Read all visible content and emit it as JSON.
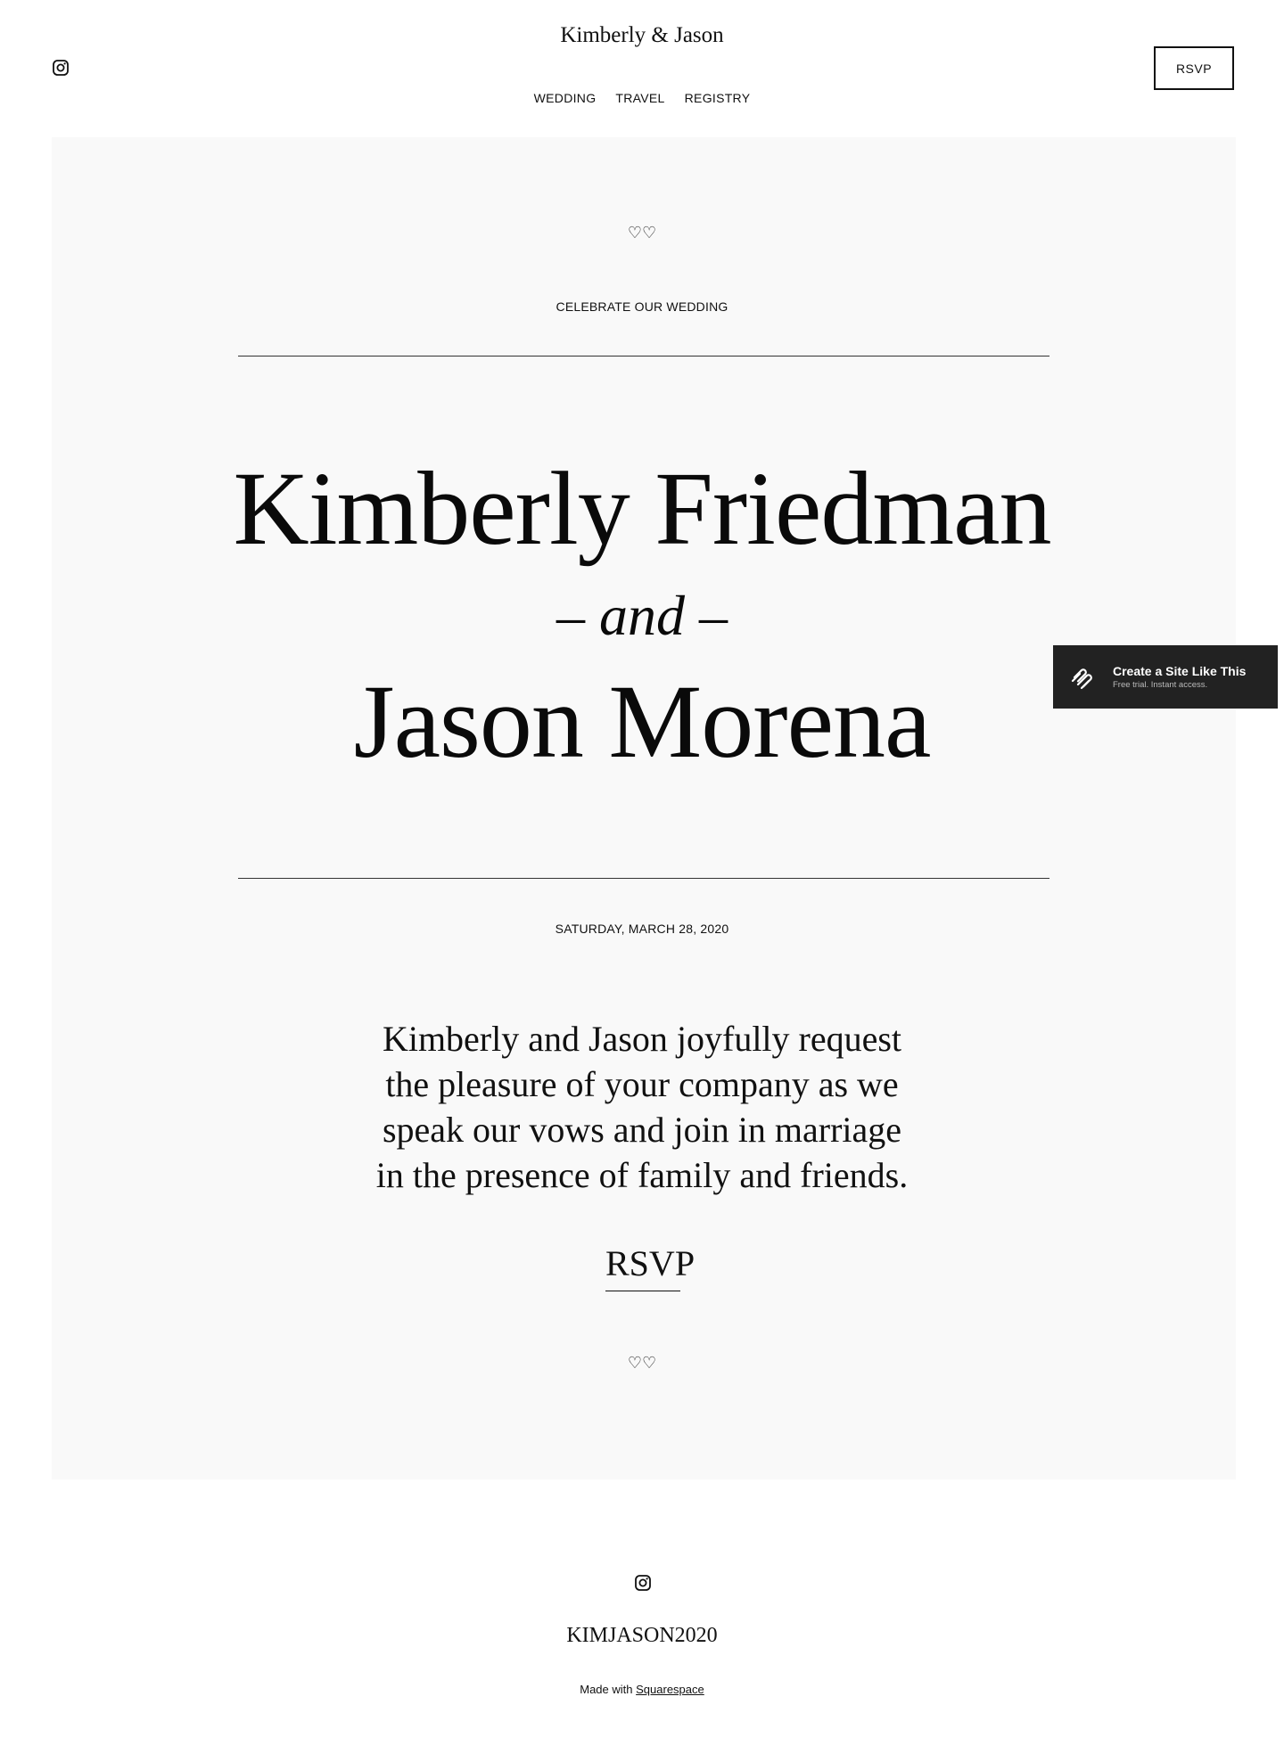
{
  "header": {
    "site_title": "Kimberly & Jason",
    "rsvp_button": "RSVP",
    "nav": [
      "WEDDING",
      "TRAVEL",
      "REGISTRY"
    ]
  },
  "hero": {
    "hearts_top": "♡♡",
    "eyebrow": "CELEBRATE OUR WEDDING",
    "name_one": "Kimberly Friedman",
    "and_prefix": "– ",
    "and_word": "and",
    "and_suffix": " –",
    "name_two": "Jason Morena",
    "date": "SATURDAY, MARCH 28, 2020",
    "invite_lines": [
      "Kimberly and Jason joyfully request",
      "the pleasure of your company as we",
      "speak our vows and join in marriage",
      "in the presence of family and friends."
    ],
    "rsvp_link": "RSVP",
    "hearts_bottom": "♡♡"
  },
  "squarespace_badge": {
    "title": "Create a Site Like This",
    "subtitle": "Free trial. Instant access."
  },
  "footer": {
    "brand": "KIMJASON2020",
    "made_with_prefix": "Made with ",
    "made_with_link": "Squarespace"
  }
}
